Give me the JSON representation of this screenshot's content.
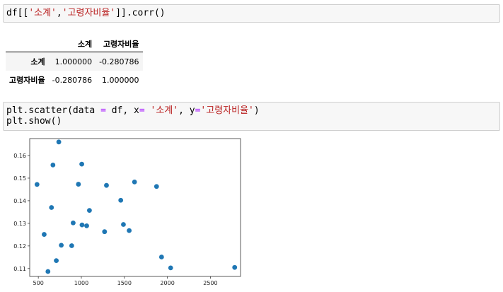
{
  "cells": [
    {
      "code_parts": [
        "df[[",
        "'소계'",
        ",",
        "'고령자비율'",
        "]].corr()"
      ]
    },
    {
      "line1_parts": [
        "plt.scatter(data ",
        "=",
        " df, x",
        "=",
        " ",
        "'소계'",
        ", y",
        "=",
        "'고령자비율'",
        ")"
      ],
      "line2": "plt.show()"
    }
  ],
  "corr_table": {
    "columns": [
      "소계",
      "고령자비율"
    ],
    "rows": [
      {
        "index": "소계",
        "values": [
          "1.000000",
          "-0.280786"
        ]
      },
      {
        "index": "고령자비율",
        "values": [
          "-0.280786",
          "1.000000"
        ]
      }
    ]
  },
  "chart_data": {
    "type": "scatter",
    "xlim": [
      400,
      2850
    ],
    "ylim": [
      0.1065,
      0.1675
    ],
    "xticks": [
      500,
      1000,
      1500,
      2000,
      2500
    ],
    "yticks": [
      0.11,
      0.12,
      0.13,
      0.14,
      0.15,
      0.16
    ],
    "ytick_labels": [
      "0.11",
      "0.12",
      "0.13",
      "0.14",
      "0.15",
      "0.16"
    ],
    "point_color": "#1f77b4",
    "points": [
      [
        485,
        0.1472
      ],
      [
        568,
        0.1251
      ],
      [
        612,
        0.1087
      ],
      [
        653,
        0.137
      ],
      [
        670,
        0.1558
      ],
      [
        709,
        0.1135
      ],
      [
        738,
        0.166
      ],
      [
        767,
        0.1203
      ],
      [
        888,
        0.1201
      ],
      [
        905,
        0.1302
      ],
      [
        966,
        0.1473
      ],
      [
        1005,
        0.1562
      ],
      [
        1008,
        0.1293
      ],
      [
        1062,
        0.1289
      ],
      [
        1094,
        0.1357
      ],
      [
        1270,
        0.1263
      ],
      [
        1292,
        0.1468
      ],
      [
        1458,
        0.1402
      ],
      [
        1489,
        0.1295
      ],
      [
        1556,
        0.1268
      ],
      [
        1618,
        0.1483
      ],
      [
        1874,
        0.1463
      ],
      [
        1932,
        0.1151
      ],
      [
        2038,
        0.1103
      ],
      [
        2782,
        0.1105
      ]
    ]
  }
}
